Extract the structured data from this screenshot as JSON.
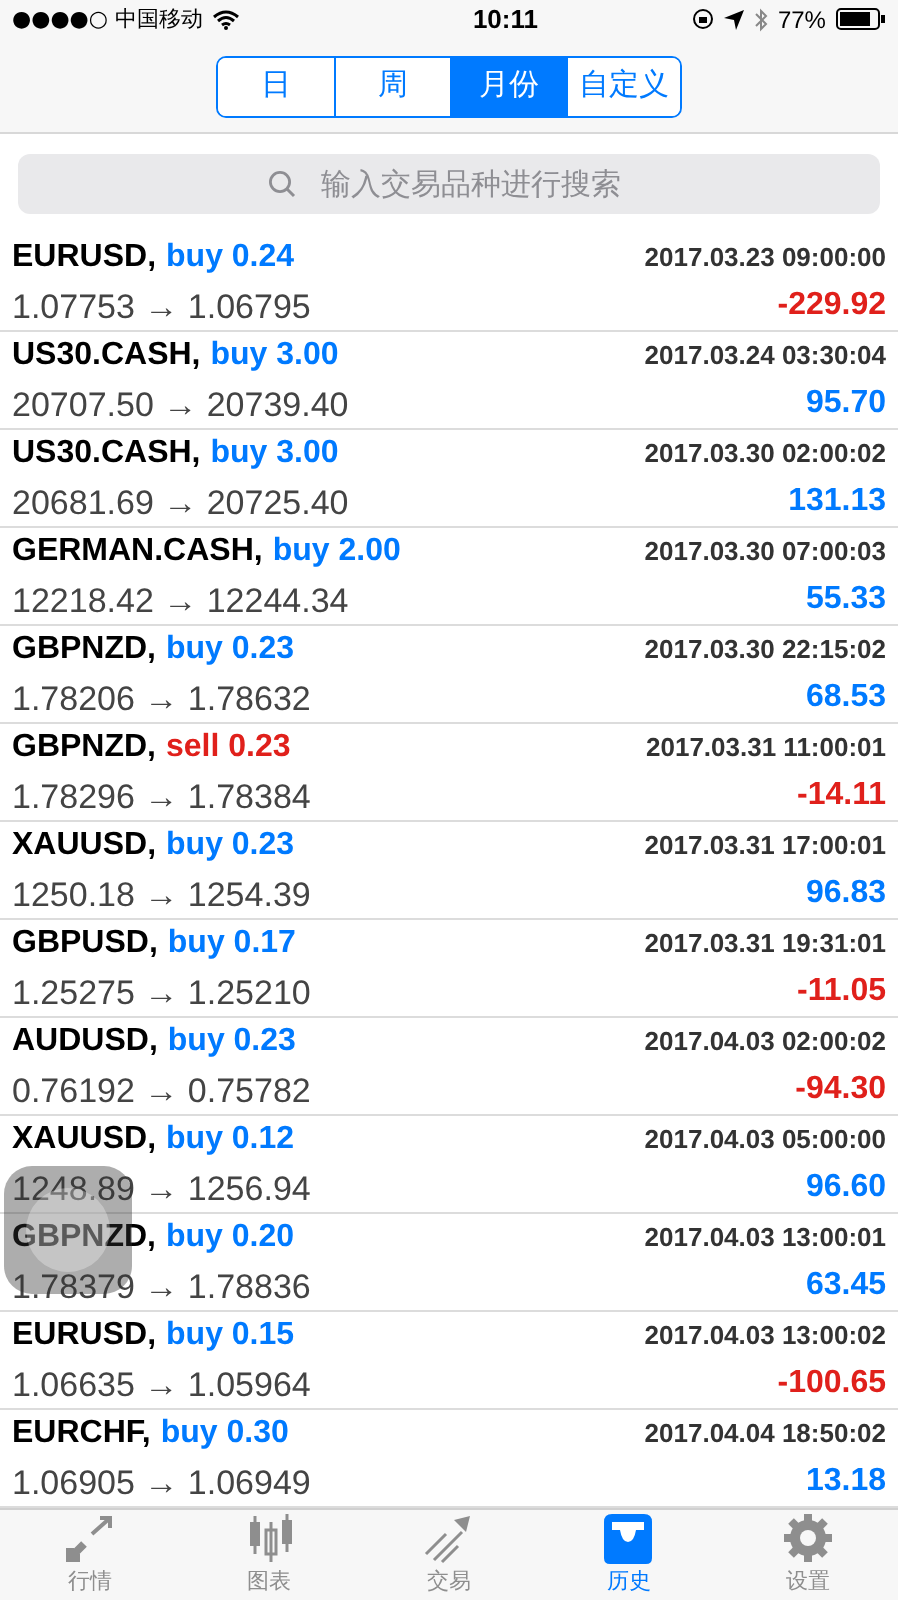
{
  "status_bar": {
    "carrier": "●●●●○ 中国移动",
    "time": "10:11",
    "battery": "77%"
  },
  "period_tabs": [
    {
      "label": "日",
      "selected": false
    },
    {
      "label": "周",
      "selected": false
    },
    {
      "label": "月份",
      "selected": true
    },
    {
      "label": "自定义",
      "selected": false
    }
  ],
  "search": {
    "placeholder": "输入交易品种进行搜索"
  },
  "deals": [
    {
      "symbol": "EURUSD,",
      "order": "buy 0.24",
      "kind": "buy",
      "time": "2017.03.23 09:00:00",
      "prices": "1.07753 → 1.06795",
      "profit": "-229.92",
      "loss": true
    },
    {
      "symbol": "US30.CASH,",
      "order": "buy 3.00",
      "kind": "buy",
      "time": "2017.03.24 03:30:04",
      "prices": "20707.50 → 20739.40",
      "profit": "95.70",
      "loss": false
    },
    {
      "symbol": "US30.CASH,",
      "order": "buy 3.00",
      "kind": "buy",
      "time": "2017.03.30 02:00:02",
      "prices": "20681.69 → 20725.40",
      "profit": "131.13",
      "loss": false
    },
    {
      "symbol": "GERMAN.CASH,",
      "order": "buy 2.00",
      "kind": "buy",
      "time": "2017.03.30 07:00:03",
      "prices": "12218.42 → 12244.34",
      "profit": "55.33",
      "loss": false
    },
    {
      "symbol": "GBPNZD,",
      "order": "buy 0.23",
      "kind": "buy",
      "time": "2017.03.30 22:15:02",
      "prices": "1.78206 → 1.78632",
      "profit": "68.53",
      "loss": false
    },
    {
      "symbol": "GBPNZD,",
      "order": "sell 0.23",
      "kind": "sell",
      "time": "2017.03.31 11:00:01",
      "prices": "1.78296 → 1.78384",
      "profit": "-14.11",
      "loss": true
    },
    {
      "symbol": "XAUUSD,",
      "order": "buy 0.23",
      "kind": "buy",
      "time": "2017.03.31 17:00:01",
      "prices": "1250.18 → 1254.39",
      "profit": "96.83",
      "loss": false
    },
    {
      "symbol": "GBPUSD,",
      "order": "buy 0.17",
      "kind": "buy",
      "time": "2017.03.31 19:31:01",
      "prices": "1.25275 → 1.25210",
      "profit": "-11.05",
      "loss": true
    },
    {
      "symbol": "AUDUSD,",
      "order": "buy 0.23",
      "kind": "buy",
      "time": "2017.04.03 02:00:02",
      "prices": "0.76192 → 0.75782",
      "profit": "-94.30",
      "loss": true
    },
    {
      "symbol": "XAUUSD,",
      "order": "buy 0.12",
      "kind": "buy",
      "time": "2017.04.03 05:00:00",
      "prices": "1248.89 → 1256.94",
      "profit": "96.60",
      "loss": false
    },
    {
      "symbol": "GBPNZD,",
      "order": "buy 0.20",
      "kind": "buy",
      "time": "2017.04.03 13:00:01",
      "prices": "1.78379 → 1.78836",
      "profit": "63.45",
      "loss": false
    },
    {
      "symbol": "EURUSD,",
      "order": "buy 0.15",
      "kind": "buy",
      "time": "2017.04.03 13:00:02",
      "prices": "1.06635 → 1.05964",
      "profit": "-100.65",
      "loss": true
    },
    {
      "symbol": "EURCHF,",
      "order": "buy 0.30",
      "kind": "buy",
      "time": "2017.04.04 18:50:02",
      "prices": "1.06905 → 1.06949",
      "profit": "13.18",
      "loss": false
    }
  ],
  "tab_bar": [
    {
      "label": "行情",
      "selected": false
    },
    {
      "label": "图表",
      "selected": false
    },
    {
      "label": "交易",
      "selected": false
    },
    {
      "label": "历史",
      "selected": true
    },
    {
      "label": "设置",
      "selected": false
    }
  ]
}
